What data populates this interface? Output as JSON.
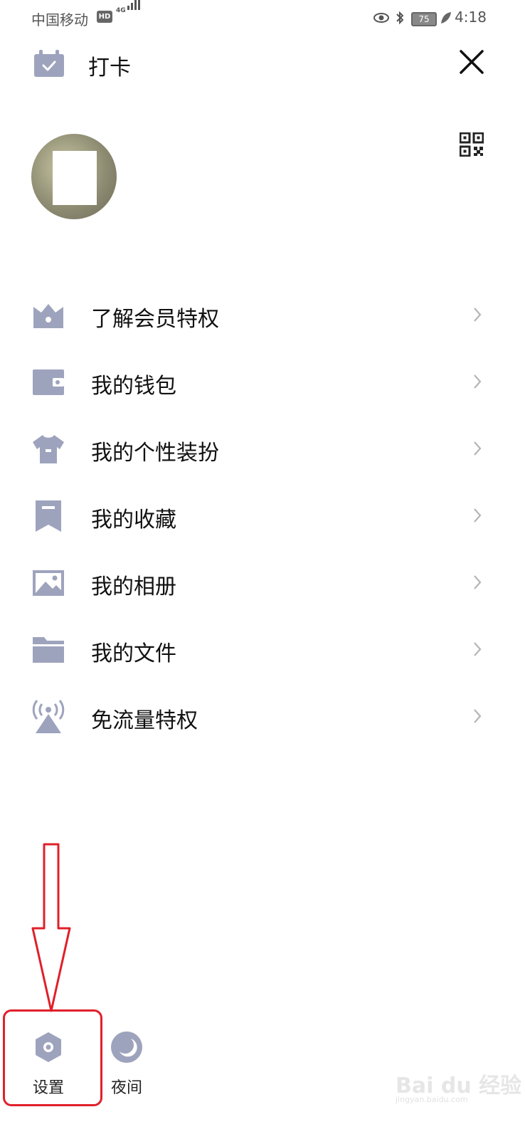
{
  "status_bar": {
    "carrier": "中国移动",
    "hd_badge": "HD",
    "network": "4G",
    "battery": "75",
    "time": "4:18"
  },
  "header": {
    "title": "打卡"
  },
  "menu": [
    {
      "label": "了解会员特权",
      "icon": "crown-icon"
    },
    {
      "label": "我的钱包",
      "icon": "wallet-icon"
    },
    {
      "label": "我的个性装扮",
      "icon": "tshirt-icon"
    },
    {
      "label": "我的收藏",
      "icon": "bookmark-icon"
    },
    {
      "label": "我的相册",
      "icon": "photo-icon"
    },
    {
      "label": "我的文件",
      "icon": "folder-icon"
    },
    {
      "label": "免流量特权",
      "icon": "signal-tower-icon"
    }
  ],
  "bottom": {
    "settings_label": "设置",
    "night_label": "夜间"
  },
  "watermark": {
    "brand": "Bai du 经验",
    "url": "jingyan.baidu.com"
  },
  "colors": {
    "icon": "#9ea3bd",
    "annotation": "#e0202a"
  }
}
